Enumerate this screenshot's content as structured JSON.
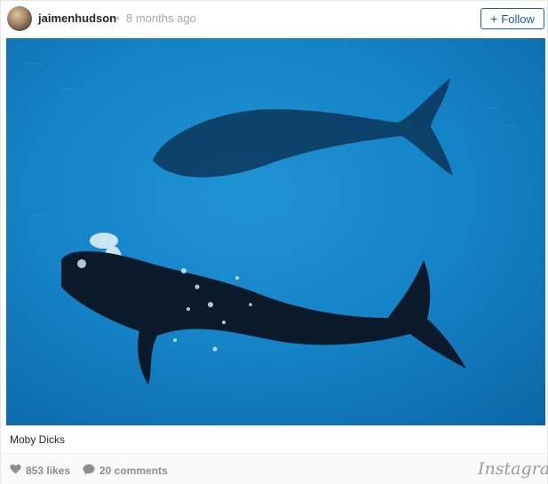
{
  "post": {
    "username": "jaimenhudson",
    "separator": "•",
    "timestamp": "8 months ago",
    "follow_label": "Follow",
    "caption": "Moby Dicks",
    "likes": "853 likes",
    "comments": "20 comments",
    "brand": "Instagram"
  },
  "icons": {
    "avatar": "profile-avatar",
    "follow": "plus-icon",
    "likes": "heart-icon",
    "comments": "speech-bubble-icon"
  },
  "colors": {
    "accent": "#1f5fa0",
    "muted": "#8e8e8e",
    "ocean": "#1381c6"
  }
}
